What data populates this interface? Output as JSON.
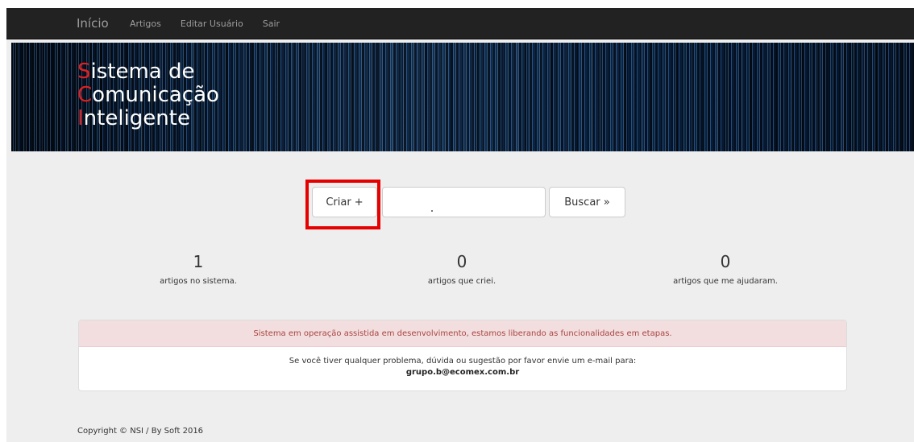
{
  "nav": {
    "brand": "Início",
    "items": [
      "Artigos",
      "Editar Usuário",
      "Sair"
    ]
  },
  "hero": {
    "lines": [
      {
        "cap": "S",
        "rest": "istema de"
      },
      {
        "cap": "C",
        "rest": "omunicação"
      },
      {
        "cap": "I",
        "rest": "nteligente"
      }
    ]
  },
  "toolbar": {
    "create_label": "Criar +",
    "search_value": "",
    "search_label": "Buscar »"
  },
  "stats": [
    {
      "value": "1",
      "label": "artigos no sistema."
    },
    {
      "value": "0",
      "label": "artigos que criei."
    },
    {
      "value": "0",
      "label": "artigos que me ajudaram."
    }
  ],
  "notice": {
    "alert": "Sistema em operação assistida em desenvolvimento, estamos liberando as funcionalidades em etapas.",
    "message": "Se você tiver qualquer problema, dúvida ou sugestão por favor envie um e-mail para:",
    "email": "grupo.b@ecomex.com.br"
  },
  "footer": {
    "copyright": "Copyright © NSI / By Soft 2016"
  },
  "colors": {
    "navbar": "#222222",
    "alert_bg": "#f2dede",
    "alert_text": "#a94442",
    "highlight": "#e60000",
    "title_cap": "#e02020"
  }
}
